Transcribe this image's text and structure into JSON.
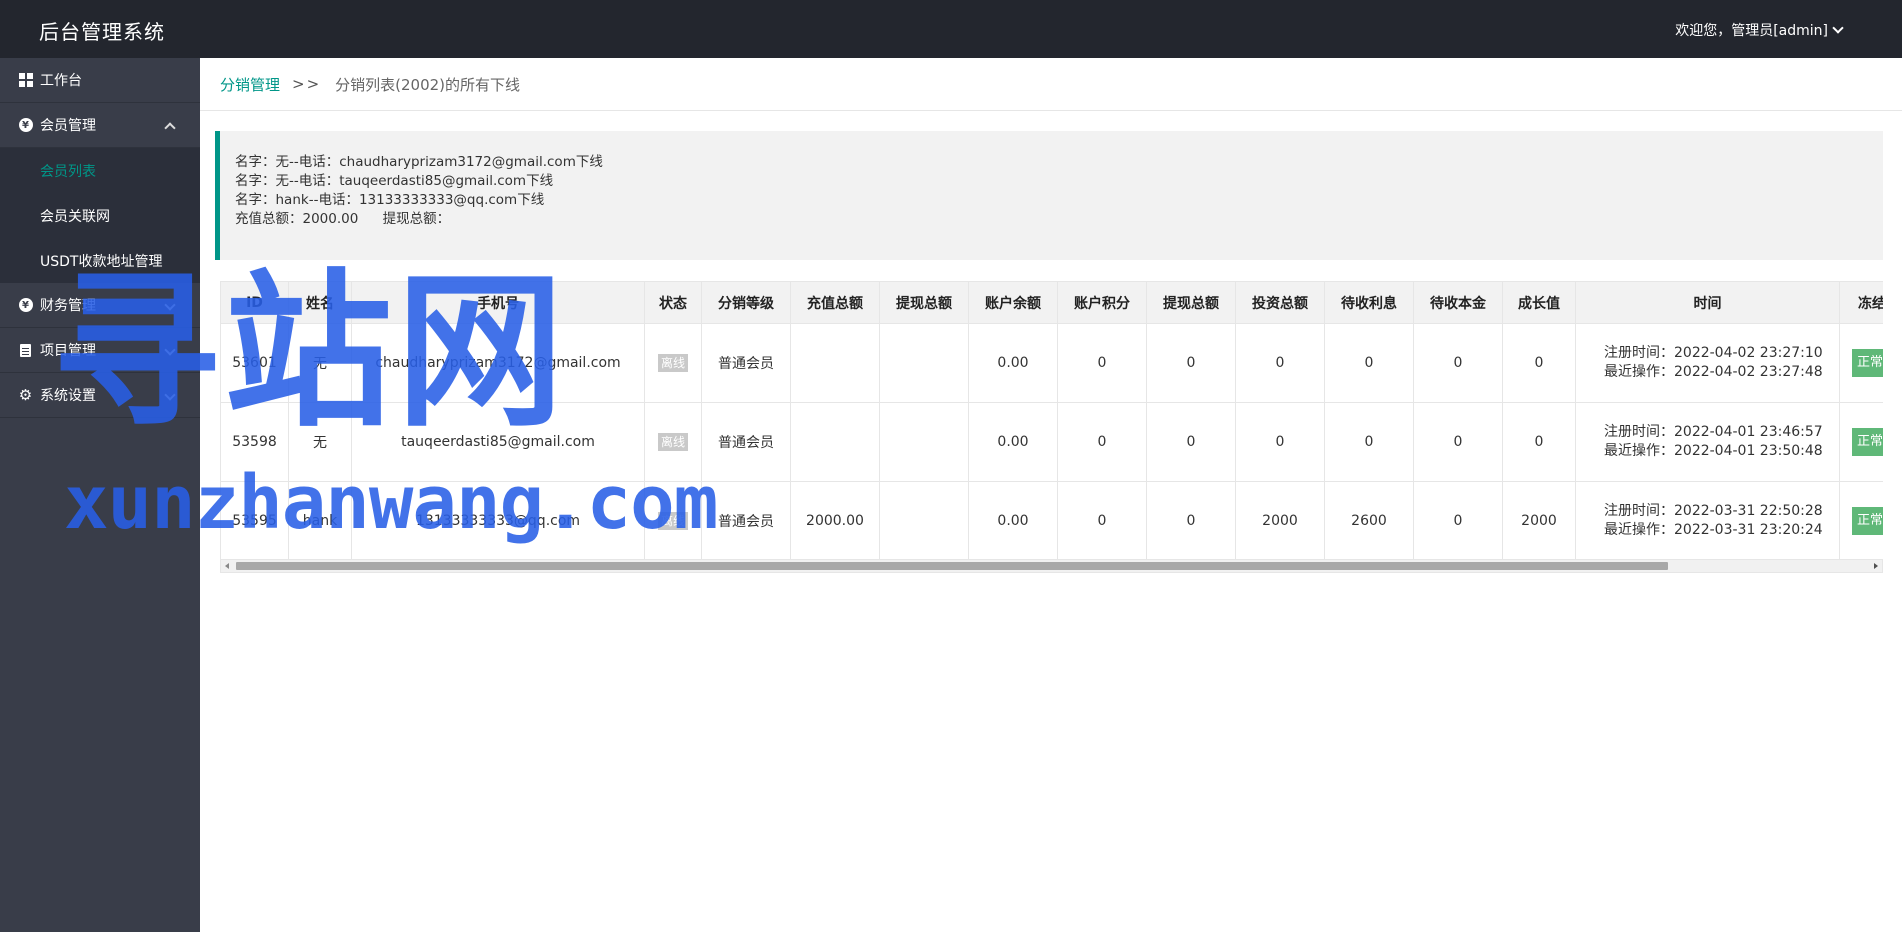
{
  "header": {
    "app_title": "后台管理系统",
    "user_greeting": "欢迎您，管理员[admin]"
  },
  "sidebar": {
    "items": [
      {
        "label": "工作台",
        "icon": "dashboard-icon"
      },
      {
        "label": "会员管理",
        "icon": "yen-circle-icon",
        "expanded": true,
        "children": [
          {
            "label": "会员列表",
            "active": true
          },
          {
            "label": "会员关联网"
          },
          {
            "label": "USDT收款地址管理"
          }
        ]
      },
      {
        "label": "财务管理",
        "icon": "yen-circle-icon"
      },
      {
        "label": "项目管理",
        "icon": "clipboard-icon"
      },
      {
        "label": "系统设置",
        "icon": "gear-icon"
      }
    ]
  },
  "breadcrumb": {
    "parent": "分销管理",
    "separator": ">>",
    "current": "分销列表(2002)的所有下线"
  },
  "info": {
    "lines": [
      "名字：无--电话：chaudharyprizam3172@gmail.com下线",
      "名字：无--电话：tauqeerdasti85@gmail.com下线",
      "名字：hank--电话：13133333333@qq.com下线"
    ],
    "recharge_total": "充值总额：2000.00",
    "withdraw_total": "提现总额："
  },
  "table": {
    "columns": [
      "ID",
      "姓名",
      "手机号",
      "状态",
      "分销等级",
      "充值总额",
      "提现总额",
      "账户余额",
      "账户积分",
      "提现总额",
      "投资总额",
      "待收利息",
      "待收本金",
      "成长值",
      "时间",
      "冻结"
    ],
    "rows": [
      {
        "id": "53601",
        "name": "无",
        "phone": "chaudharyprizam3172@gmail.com",
        "status": "离线",
        "level": "普通会员",
        "recharge": "",
        "withdraw": "",
        "balance": "0.00",
        "points": "0",
        "withdraw_total": "0",
        "invest": "0",
        "pending_interest": "0",
        "pending_principal": "0",
        "growth": "0",
        "reg_time": "注册时间：2022-04-02 23:27:10",
        "last_op": "最近操作：2022-04-02 23:27:48",
        "freeze": "正常"
      },
      {
        "id": "53598",
        "name": "无",
        "phone": "tauqeerdasti85@gmail.com",
        "status": "离线",
        "level": "普通会员",
        "recharge": "",
        "withdraw": "",
        "balance": "0.00",
        "points": "0",
        "withdraw_total": "0",
        "invest": "0",
        "pending_interest": "0",
        "pending_principal": "0",
        "growth": "0",
        "reg_time": "注册时间：2022-04-01 23:46:57",
        "last_op": "最近操作：2022-04-01 23:50:48",
        "freeze": "正常"
      },
      {
        "id": "53595",
        "name": "hank",
        "phone": "13133333333@qq.com",
        "status": "离线",
        "level": "普通会员",
        "recharge": "2000.00",
        "withdraw": "",
        "balance": "0.00",
        "points": "0",
        "withdraw_total": "0",
        "invest": "2000",
        "pending_interest": "2600",
        "pending_principal": "0",
        "growth": "2000",
        "reg_time": "注册时间：2022-03-31 22:50:28",
        "last_op": "最近操作：2022-03-31 23:20:24",
        "freeze": "正常"
      }
    ]
  },
  "watermark": {
    "cn": "寻站网",
    "en": "xunzhanwang.com"
  },
  "colors": {
    "header_bg": "#23262e",
    "sidebar_bg": "#393d49",
    "accent": "#009688",
    "badge_offline": "#c9c9c9",
    "badge_normal": "#5fb878",
    "watermark": "#285fe6"
  }
}
